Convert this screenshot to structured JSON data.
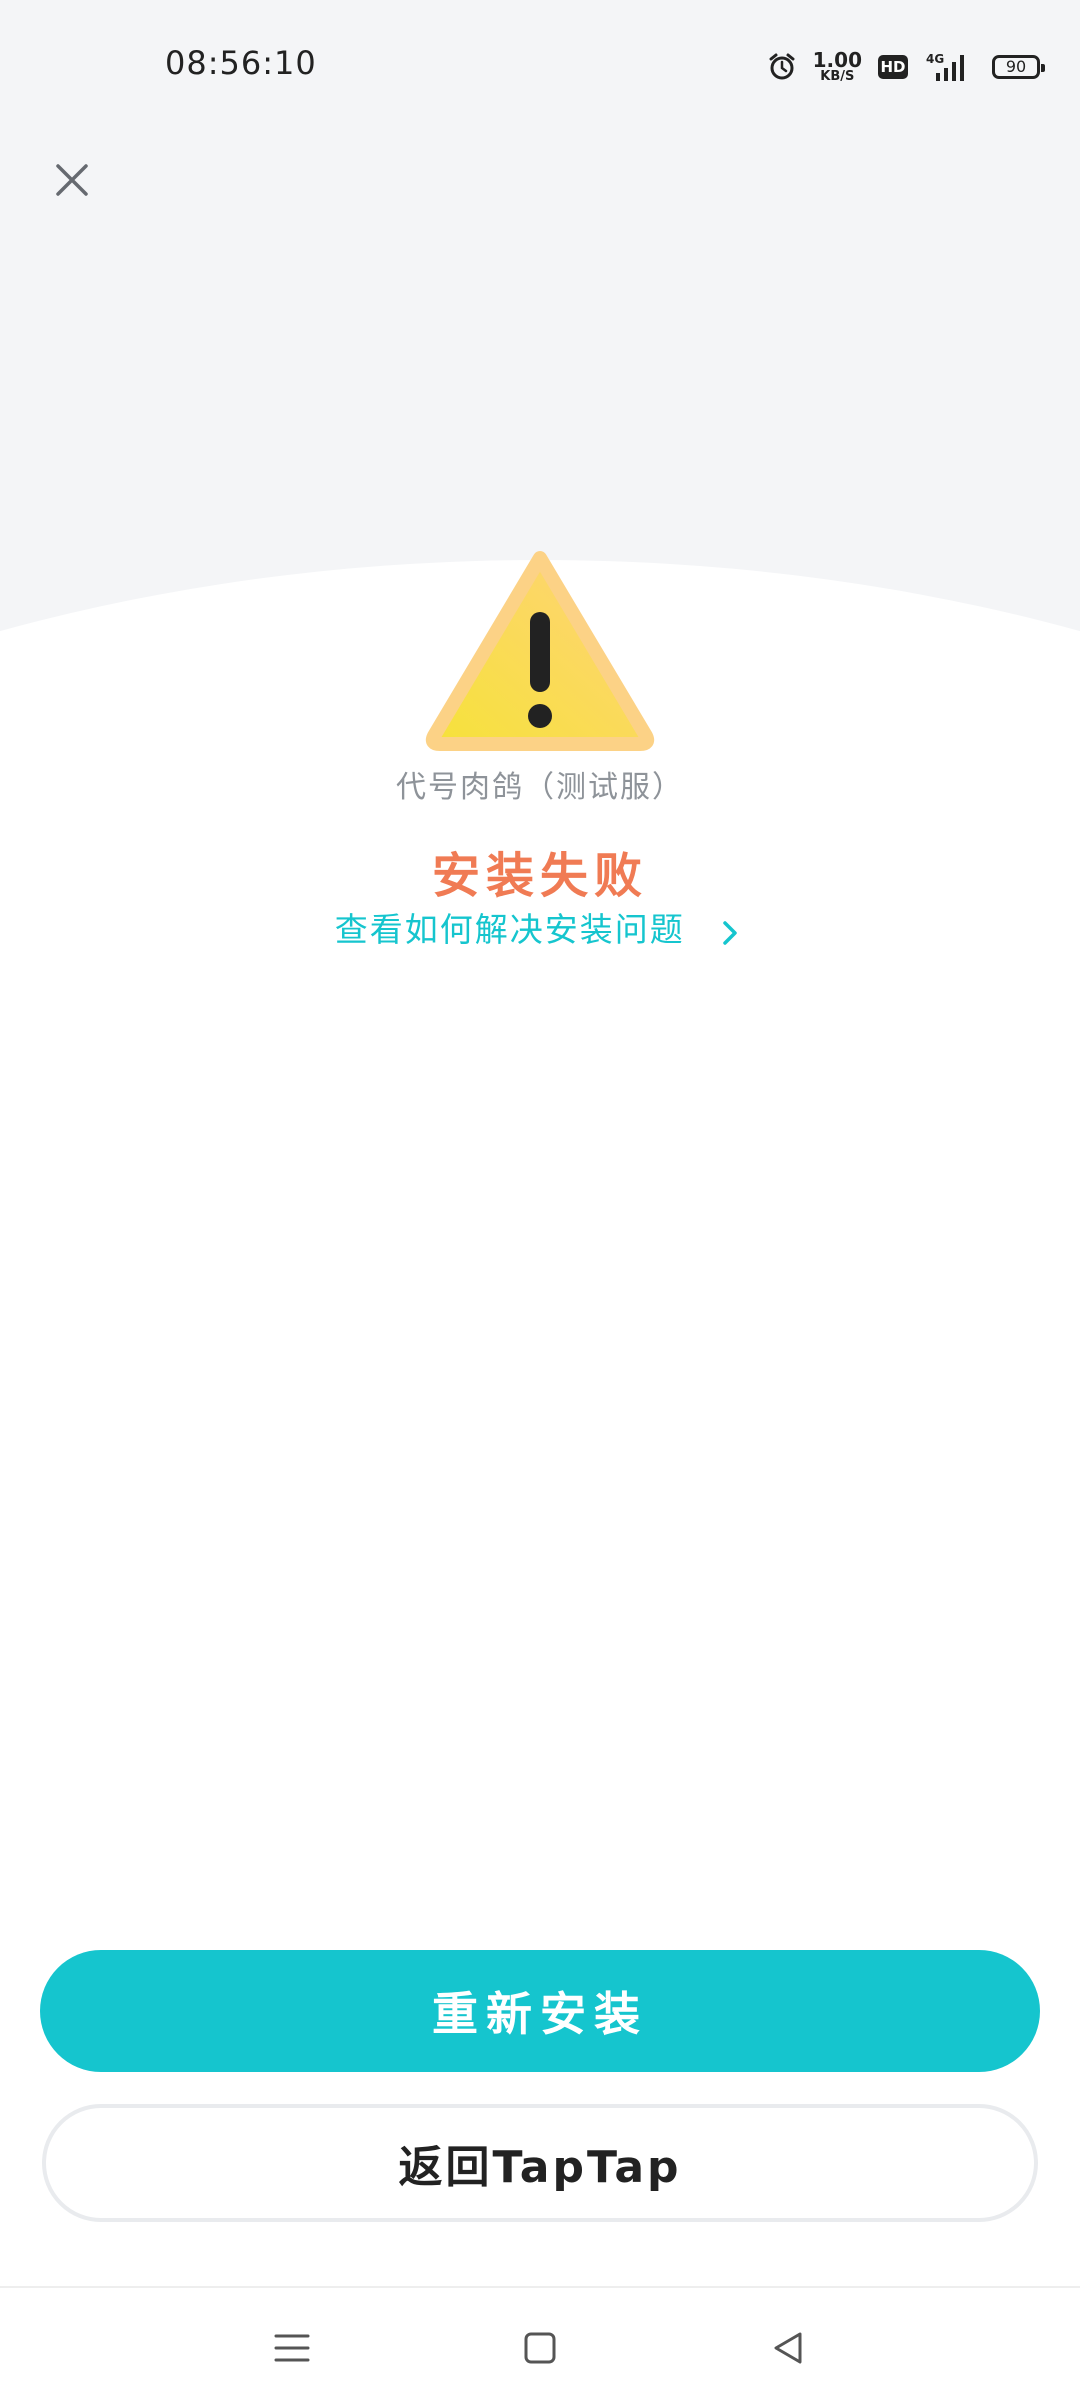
{
  "status_bar": {
    "time": "08:56:10",
    "net_speed_value": "1.00",
    "net_speed_unit": "KB/S",
    "hd_label": "HD",
    "network_label": "4G",
    "battery_level": "90",
    "icons": [
      "alarm-icon",
      "hd-icon",
      "signal-icon",
      "battery-icon"
    ]
  },
  "header": {
    "close_icon": "close-icon"
  },
  "content": {
    "warning_icon": "warning-triangle-icon",
    "game_name": "代号肉鸽（测试服）",
    "status_title": "安装失败",
    "help_link_label": "查看如何解决安装问题",
    "help_link_icon": "chevron-right-icon"
  },
  "actions": {
    "reinstall_label": "重新安装",
    "back_label": "返回TapTap"
  },
  "nav_bar": {
    "icons": [
      "menu-icon",
      "home-icon",
      "back-icon"
    ]
  },
  "colors": {
    "accent": "#15c5ce",
    "error": "#f07b54",
    "muted_text": "#8e9399",
    "header_bg": "#f4f5f7"
  }
}
